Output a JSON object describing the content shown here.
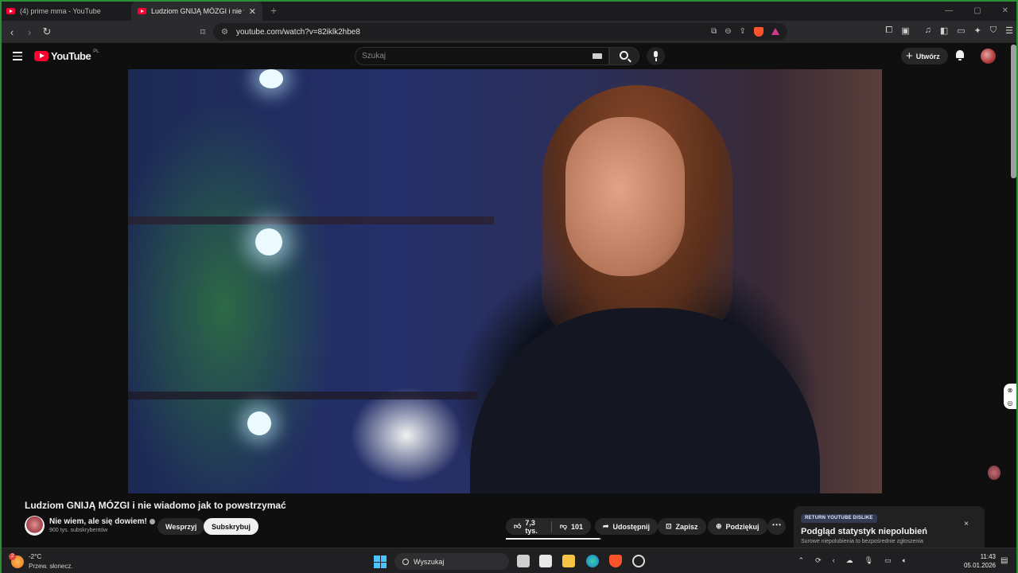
{
  "browser": {
    "tabs": [
      {
        "title": "(4) prime mma - YouTube",
        "active": false
      },
      {
        "title": "Ludziom GNIJĄ MÓZGI i nie wia",
        "active": true
      }
    ],
    "new_tab": "+",
    "url": "youtube.com/watch?v=82iklk2hbe8",
    "window_controls": [
      "—",
      "▢",
      "✕"
    ]
  },
  "youtube": {
    "logo_text": "YouTube",
    "country_code": "PL",
    "search_placeholder": "Szukaj",
    "create_label": "Utwórz"
  },
  "video": {
    "title": "Ludziom GNIJĄ MÓZGI i nie wiadomo jak to powstrzymać",
    "channel": "Nie wiem, ale się dowiem!",
    "subscribers": "900 tys. subskrybentów",
    "support_label": "Wesprzyj",
    "subscribe_label": "Subskrybuj",
    "likes": "7,3 tys.",
    "dislikes": "101",
    "like_ratio": 0.986,
    "share_label": "Udostępnij",
    "save_label": "Zapisz",
    "thanks_label": "Podziękuj",
    "more_label": "⋯"
  },
  "ryd_popup": {
    "badge": "RETURN YOUTUBE DISLIKE",
    "heading": "Podgląd statystyk niepolubień",
    "description": "Surowe niepolubienia to bezpośrednie zgłoszenia",
    "close": "×"
  },
  "taskbar": {
    "temperature": "-2°C",
    "weather": "Przew. słonecz.",
    "weather_badge": "2",
    "search_label": "Wyszukaj",
    "time": "11:43",
    "date": "05.01.2026"
  },
  "colors": {
    "yt_red": "#ff0033",
    "background": "#0f0f0f",
    "button_bg": "#272727",
    "window_border": "#2a8f35"
  }
}
